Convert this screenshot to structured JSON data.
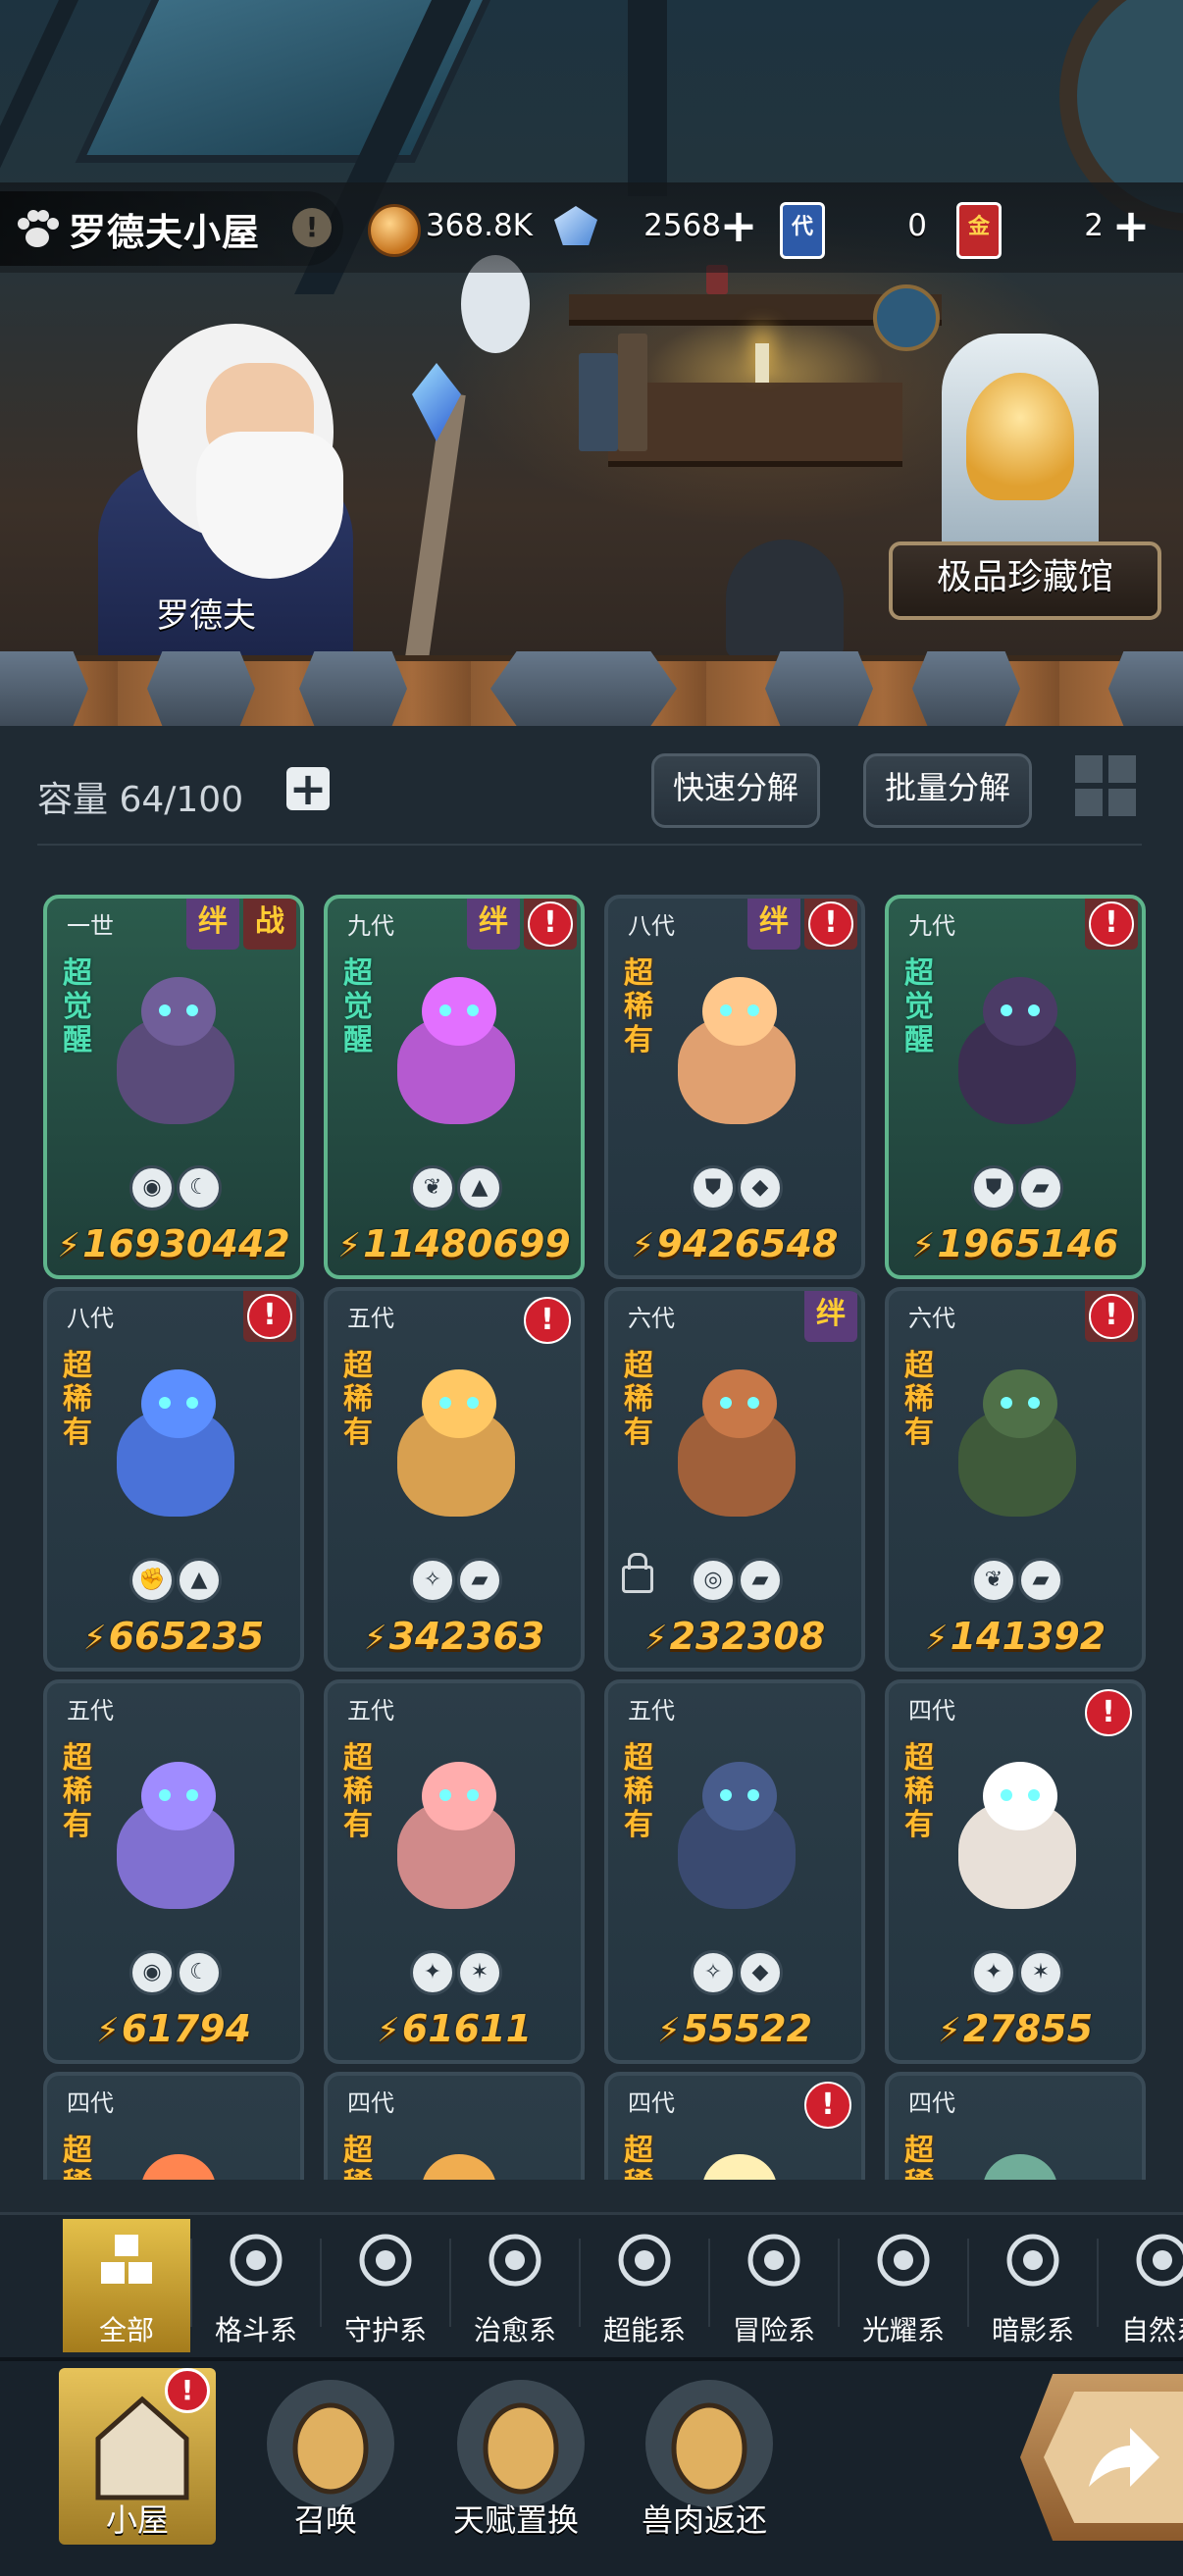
{
  "header": {
    "room_title": "罗德夫小屋",
    "info_icon": "info-icon",
    "resources": [
      {
        "name": "gold",
        "icon": "coin-icon",
        "value": "368.8K"
      },
      {
        "name": "gem",
        "icon": "gem-icon",
        "value": "2568"
      },
      {
        "name": "substitute_card",
        "icon": "card-icon",
        "glyph": "代",
        "value": "0"
      },
      {
        "name": "gold_card",
        "icon": "card-icon",
        "glyph": "金",
        "value": "2"
      }
    ],
    "keeper_name": "罗德夫",
    "museum_label": "极品珍藏馆"
  },
  "storage": {
    "capacity_label": "容量",
    "capacity_value": "64/100",
    "quick_decompose": "快速分解",
    "batch_decompose": "批量分解"
  },
  "badges": {
    "bond": "绊",
    "battle": "战",
    "alert": "!"
  },
  "pets": [
    {
      "gen": "一世",
      "tier": "超觉醒",
      "awake": true,
      "power": "16930442",
      "elements": [
        "eye",
        "moon"
      ],
      "bond": true,
      "battle": true,
      "alert": false,
      "creature": "#5a4b7a"
    },
    {
      "gen": "九代",
      "tier": "超觉醒",
      "awake": true,
      "power": "11480699",
      "elements": [
        "leaf",
        "fire"
      ],
      "bond": true,
      "alert": true,
      "alert_boxed": true,
      "creature": "#b55ad0"
    },
    {
      "gen": "八代",
      "tier": "超稀有",
      "awake": false,
      "power": "9426548",
      "elements": [
        "shield",
        "drop"
      ],
      "bond": true,
      "alert": true,
      "alert_boxed": true,
      "creature": "#e0a070"
    },
    {
      "gen": "九代",
      "tier": "超觉醒",
      "awake": true,
      "power": "1965146",
      "elements": [
        "shield",
        "rock"
      ],
      "alert": true,
      "alert_boxed": true,
      "creature": "#3c2f52"
    },
    {
      "gen": "八代",
      "tier": "超稀有",
      "awake": false,
      "power": "665235",
      "elements": [
        "fist",
        "fire"
      ],
      "alert": true,
      "alert_boxed": true,
      "creature": "#4a72d8"
    },
    {
      "gen": "五代",
      "tier": "超稀有",
      "awake": false,
      "power": "342363",
      "elements": [
        "wind",
        "rock"
      ],
      "alert": true,
      "creature": "#d8a050"
    },
    {
      "gen": "六代",
      "tier": "超稀有",
      "awake": false,
      "power": "232308",
      "elements": [
        "ring",
        "rock"
      ],
      "bond": true,
      "locked": true,
      "creature": "#a0603a"
    },
    {
      "gen": "六代",
      "tier": "超稀有",
      "awake": false,
      "power": "141392",
      "elements": [
        "leaf",
        "rock"
      ],
      "alert": true,
      "alert_boxed": true,
      "creature": "#3f5a3a"
    },
    {
      "gen": "五代",
      "tier": "超稀有",
      "awake": false,
      "power": "61794",
      "elements": [
        "eye",
        "moon"
      ],
      "creature": "#8070d0"
    },
    {
      "gen": "五代",
      "tier": "超稀有",
      "awake": false,
      "power": "61611",
      "elements": [
        "star4",
        "star6"
      ],
      "creature": "#d08a8a"
    },
    {
      "gen": "五代",
      "tier": "超稀有",
      "awake": false,
      "power": "55522",
      "elements": [
        "wind",
        "drop"
      ],
      "creature": "#3a4a70"
    },
    {
      "gen": "四代",
      "tier": "超稀有",
      "awake": false,
      "power": "27855",
      "elements": [
        "star4",
        "star6"
      ],
      "alert": true,
      "creature": "#e8e0d8"
    },
    {
      "gen": "四代",
      "tier": "超稀有",
      "awake": false,
      "power": "",
      "elements": [],
      "creature": "#d06a40"
    },
    {
      "gen": "四代",
      "tier": "超稀有",
      "awake": false,
      "power": "",
      "elements": [],
      "creature": "#c08a40"
    },
    {
      "gen": "四代",
      "tier": "超稀有",
      "awake": false,
      "power": "",
      "elements": [],
      "alert": true,
      "creature": "#d0c090"
    },
    {
      "gen": "四代",
      "tier": "超稀有",
      "awake": false,
      "power": "",
      "elements": [],
      "creature": "#5a8a7a"
    }
  ],
  "filters": [
    {
      "label": "全部",
      "icon": "all-icon",
      "active": true
    },
    {
      "label": "格斗系",
      "icon": "fist-icon"
    },
    {
      "label": "守护系",
      "icon": "shield-icon"
    },
    {
      "label": "治愈系",
      "icon": "sprout-icon"
    },
    {
      "label": "超能系",
      "icon": "alien-icon"
    },
    {
      "label": "冒险系",
      "icon": "adventure-icon"
    },
    {
      "label": "光耀系",
      "icon": "light-icon"
    },
    {
      "label": "暗影系",
      "icon": "shadow-icon"
    },
    {
      "label": "自然系",
      "icon": "nature-icon"
    }
  ],
  "nav": [
    {
      "label": "小屋",
      "icon": "house-icon",
      "active": true,
      "badge": "!"
    },
    {
      "label": "召唤",
      "icon": "egg-icon"
    },
    {
      "label": "天赋置换",
      "icon": "swap-icon"
    },
    {
      "label": "兽肉返还",
      "icon": "meat-icon"
    }
  ],
  "colors": {
    "power": "#ffbf3d",
    "accent_gold": "#e4c04a",
    "alert_red": "#d01f2d",
    "awake_green": "#4ee0b3",
    "rare_orange": "#ffba2e"
  }
}
